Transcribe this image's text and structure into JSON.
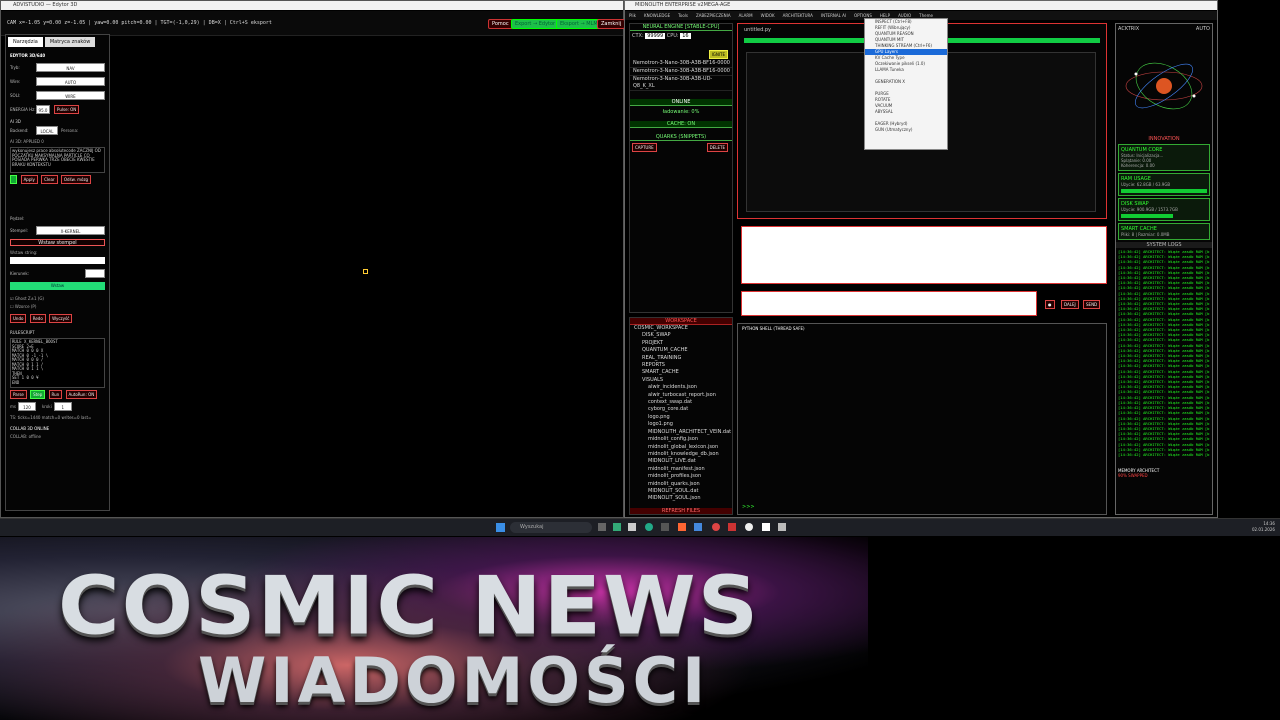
{
  "left_window": {
    "title": "ADVISTUDIO — Edytor 3D",
    "infobar": "CAM x=-1.05 y=0.00 z=-1.05 | yaw=0.00 pitch=0.00 | TGT=(-1,0,29) | DB=X | Ctrl+S eksport",
    "buttons": {
      "help": "Pomoc",
      "export_3d": "Export → Edytor",
      "export_ml": "Eksport → MLM",
      "close": "Zamknij"
    },
    "tabs": [
      "Narzędzia",
      "Matryca znaków"
    ],
    "panel": {
      "header": "EDYTOR 3D/640",
      "tryb_label": "Tryb:",
      "tryb_value": "NAV",
      "widok_label": "Wire:",
      "widok_value": "AUTO",
      "solid_label": "SOLI:",
      "solid_value": "WIRE",
      "energy_label": "ENERGIA Hz:",
      "energy_value": "95.0",
      "pulse": "Pulse: ON",
      "ai_label": "AI 3D",
      "backend_label": "Backend:",
      "backend_value": "LOCAL",
      "persona_label": "Persona:",
      "ai_status": "AI 3D: APPLIED 0",
      "ai_text": "wykonujesz prace absolutecode ZACZNIJ OD POCZATKU MAKSYMALNA PARTICLE CO POSIADA PERWKA TRZE OBECIE KWESTIE BRAKU KONTEKSTU",
      "ai_btns": [
        "Apply",
        "Clear",
        "Odśw. mózg"
      ],
      "pedzel_label": "Pędzel:",
      "stempel_label": "Stempel:",
      "stempel_value": "X-KERNEL",
      "wstaw_stempel": "Wstaw stempel",
      "wstaw_string": "Wstaw string:",
      "kierunek": "Kierunek:",
      "wstaw": "Wstaw",
      "ghost": "Ghost Z±1 (G)",
      "wzorce": "Wzorce (P)",
      "edit_btns": [
        "Undo",
        "Redo",
        "Wyczyść"
      ],
      "rule_header": "RULESCRIPT",
      "rules": [
        "RULE X_KERNEL_BOOST",
        "SCORE 2+E",
        "MATCH 0 0 0 X",
        "MATCH 0 -1 -1 \\",
        "MATCH 0 0 0 /",
        "MATCH 0 1 1 /",
        "MATCH 0 1 1 \\",
        "THEN",
        "SET 1 0 0 ¥",
        "END"
      ],
      "run_btns": [
        "Parse",
        "Step",
        "Run",
        "AutoRun: ON"
      ],
      "ms_label": "ms",
      "ms_value": "120",
      "kroki_label": "kroki",
      "kroki_value": "1",
      "stats": "TS: ticks=1440 match=0 writes=0 last=",
      "collab": "COLLAB 3D ONLINE",
      "collab_status": "COLLAB: offline"
    }
  },
  "right_window": {
    "title": "MIDNOLITH ENTERPRISE v2MEGA-AGE",
    "menu": [
      "Plik",
      "KNOWLEDGE",
      "Tools",
      "ZABEZPIECZENIA",
      "ALARM",
      "WIDOK",
      "ARCHITEKTURA",
      "INTERNAL AI",
      "OPTIONS",
      "HELP",
      "AUDIO",
      "Theme"
    ],
    "neural_engine": "NEURAL ENGINE [STABLE-CPU]",
    "ctx_label": "CTX:",
    "ctx_value": "99999",
    "cpu_label": "CPU:",
    "cpu_value": "16",
    "ignite": "IGNITE",
    "models": [
      "Nemotron-3-Nano-30B-A3B-BF16-0000",
      "Nemotron-3-Nano-30B-A3B-BF16-0000",
      "Nemotron-3-Nano-30B-A3B-UD-Q8_K_XL"
    ],
    "online": "ONLINE",
    "loading": "ładowanie: 0%",
    "cache": "CACHE: ON",
    "quarks": "QUARKS (SNIPPETS)",
    "capture": "CAPTURE",
    "delete": "DELETE",
    "workspace": "WORKSPACE",
    "tree": [
      "COSMIC_WORKSPACE",
      "DISK_SWAP",
      "PROJEKT",
      "QUANTUM_CACHE",
      "REAL_TRAINING",
      "REPORTS",
      "SMART_CACHE",
      "VISUALS",
      "alwir_incidents.json",
      "alwir_turbocast_report.json",
      "context_swap.dat",
      "cyborg_core.dat",
      "logo.png",
      "logo1.png",
      "MIDNOLITH_ARCHITECT_VEIN.dat",
      "midnolit_config.json",
      "midnolit_global_lexicon.json",
      "midnolit_knowledge_db.json",
      "MIDNOLIT_LIVE.dat",
      "midnolit_manifest.json",
      "midnolit_profiles.json",
      "midnolit_quarks.json",
      "MIDNOLIT_SOUL.dat",
      "MIDNOLIT_SOUL.json"
    ],
    "refresh": "REFRESH FILES",
    "editor_tab": "untitled.py",
    "python_shell": "PYTHON SHELL (THREAD SAFE)",
    "send": "SEND",
    "dale": "DALEJ",
    "prompt": ">>>",
    "acktrix": "ACKTRIX",
    "auto": "AUTO",
    "status_ring": "INNOVATION",
    "quantum_core": "QUANTUM CORE",
    "quantum_status": "Status: Inicjalizacja...",
    "quantum_splat": "Splątanie: 0.00",
    "quantum_koh": "Koherencja: 0.00",
    "ram_usage": "RAM USAGE",
    "ram_value": "Użycie: 62.8GB / 63.9GB",
    "disk_swap": "DISK SWAP",
    "disk_value": "Użycie: 900.9GB / 1573.7GB",
    "smart_cache": "SMART CACHE",
    "smart_value": "Pliki: 8 | Rozmiar: 0.0MB",
    "system_logs": "SYSTEM LOGS",
    "log_line": "[14:36:42] ARCHITECT: Wiąże zasób RAM [b.",
    "memory_architect": "MEMORY ARCHITECT",
    "swapped": "90% SWAPPED"
  },
  "popup_menu": {
    "items": [
      "INSPECT (Ctrl+F8)",
      "REFIT (Wibrujący)",
      "QUANTUM REASON",
      "QUANTUM MIT",
      "THINKING STREAM (Ctrl+F6)",
      "GPU Layers",
      "KV Cache Type",
      "Oczekiwanie pikseli (1.0)",
      "LLAMA Tuneka",
      "",
      "GENERATION X",
      "",
      "PURGE",
      "ROTATE",
      "VACUUM",
      "ABYSSAL",
      "",
      "EAGER (Hybryd)",
      "GUN (Utmatyczny)"
    ],
    "highlighted": "GPU Layers"
  },
  "taskbar": {
    "search": "Wyszukaj",
    "time": "14:36",
    "date": "02.01.2026"
  },
  "banner": {
    "title": "COSMIC NEWS",
    "subtitle": "WIADOMOŚCI"
  }
}
